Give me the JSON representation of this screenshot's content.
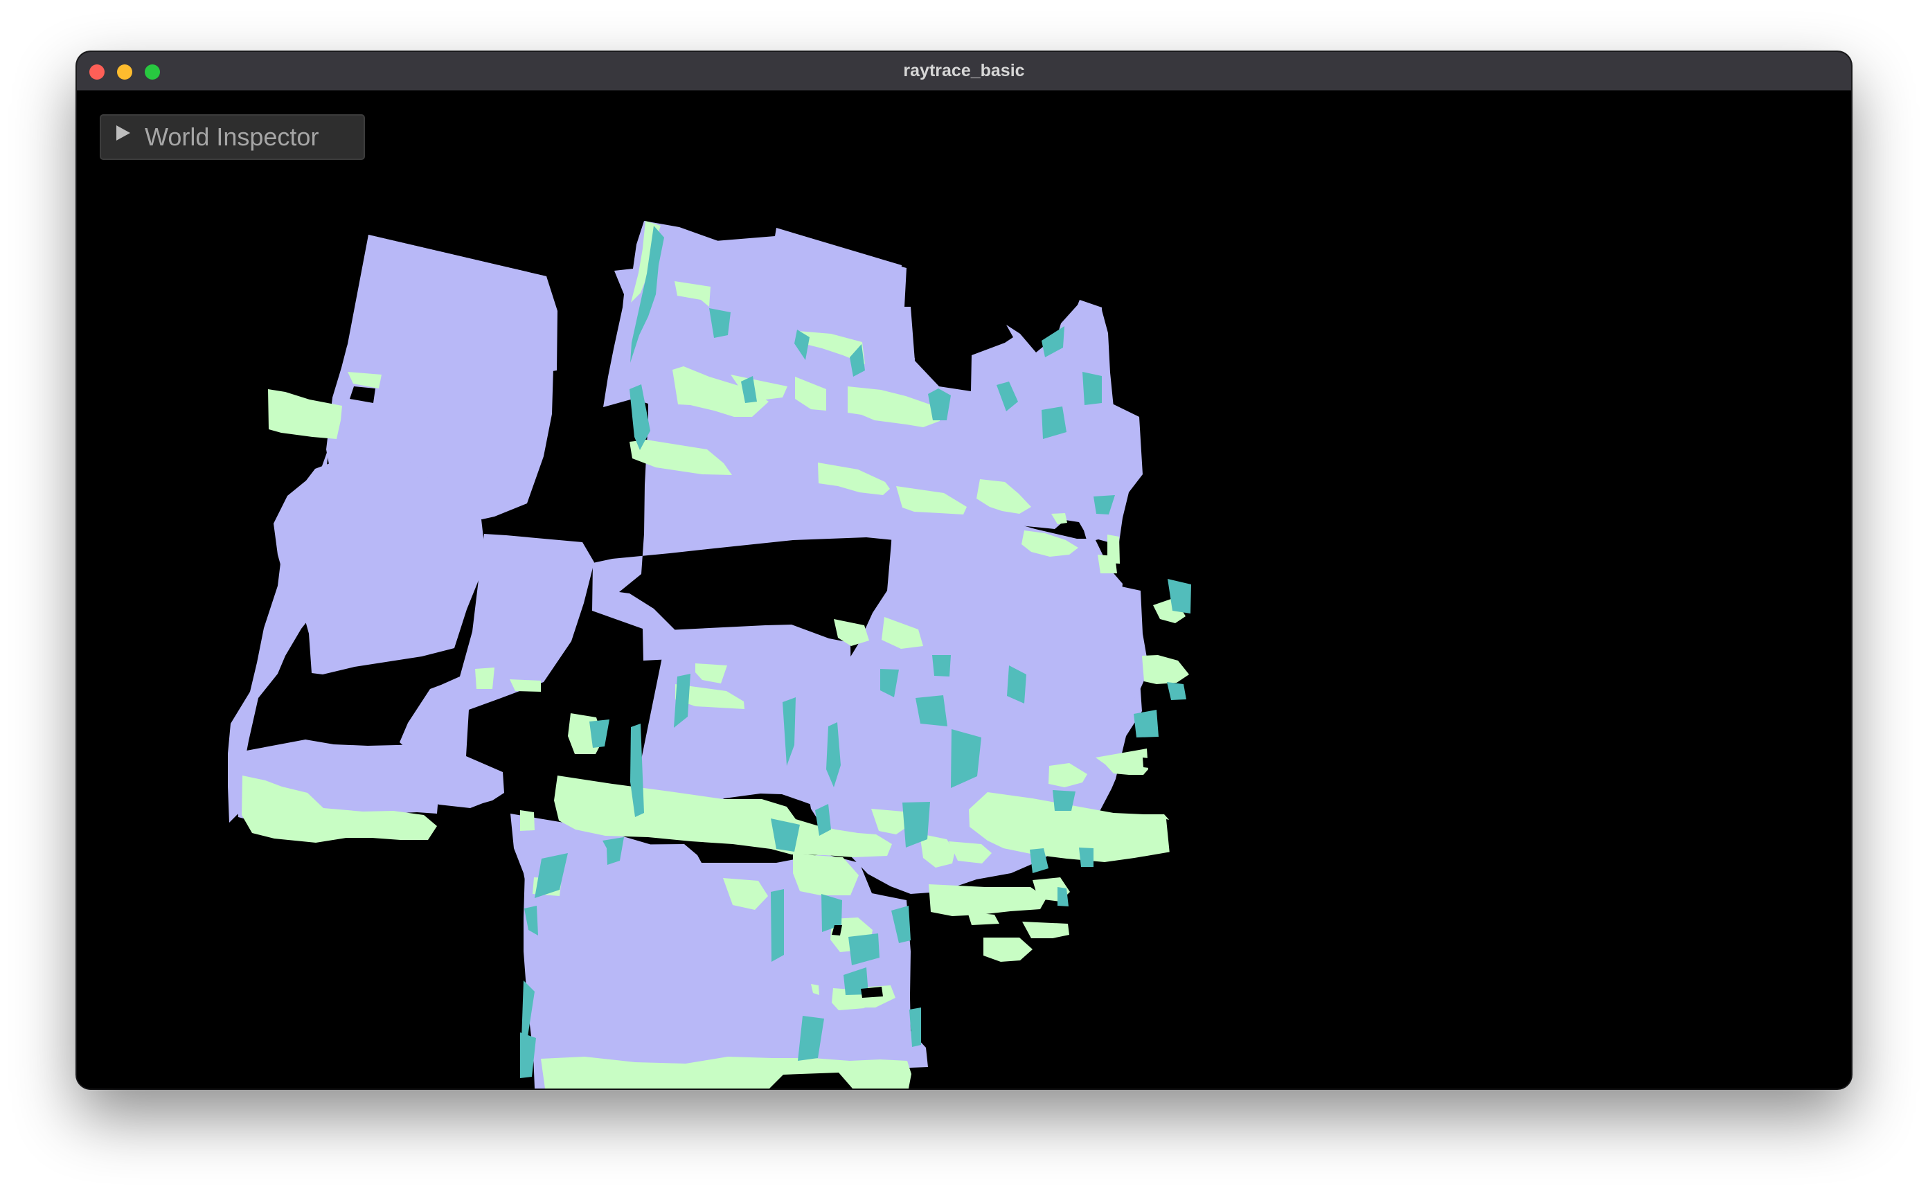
{
  "window": {
    "title": "raytrace_basic"
  },
  "inspector": {
    "label": "World Inspector",
    "icon": "triangle-right-icon"
  },
  "colors": {
    "titlebar": "#38373d",
    "close": "#fe5f57",
    "minimize": "#febc2e",
    "maximize": "#28c840",
    "face_lavender": "#b8b8f7",
    "face_mint": "#c8fdc4",
    "face_teal": "#52bdbb",
    "background": "#000000"
  }
}
